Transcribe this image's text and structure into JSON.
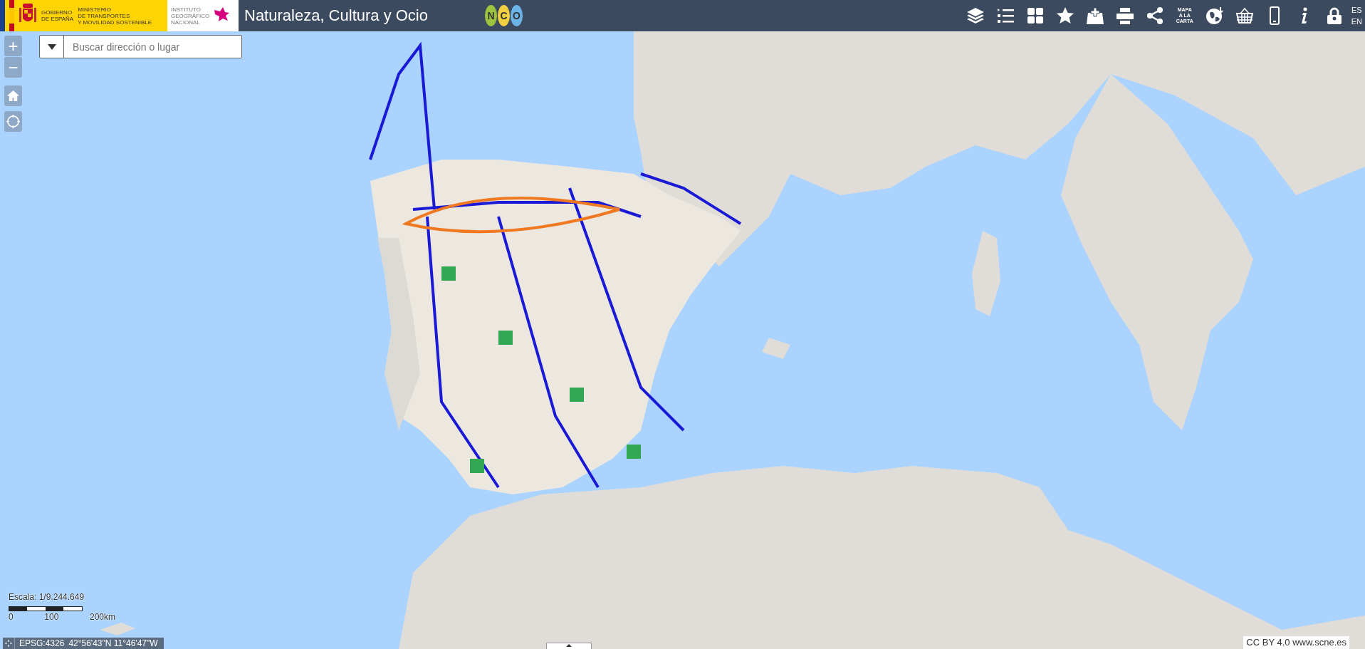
{
  "header": {
    "government": [
      "GOBIERNO",
      "DE ESPAÑA"
    ],
    "ministry": [
      "MINISTERIO",
      "DE TRANSPORTES",
      "Y MOVILIDAD SOSTENIBLE"
    ],
    "institute": [
      "INSTITUTO",
      "GEOGRÁFICO",
      "NACIONAL"
    ],
    "title": "Naturaleza, Cultura y Ocio",
    "app_logo": [
      "N",
      "C",
      "O"
    ]
  },
  "toolbar": [
    {
      "kind": "icon"
    },
    {
      "kind": "icon"
    },
    {
      "kind": "icon"
    },
    {
      "kind": "icon"
    },
    {
      "kind": "icon"
    },
    {
      "kind": "icon"
    },
    {
      "kind": "icon"
    },
    {
      "kind": "text",
      "lines": [
        "MAPA",
        "A LA",
        "CARTA"
      ]
    },
    {
      "kind": "icon"
    },
    {
      "kind": "icon"
    },
    {
      "kind": "icon"
    },
    {
      "kind": "icon"
    },
    {
      "kind": "icon"
    }
  ],
  "languages": [
    "ES",
    "EN"
  ],
  "map": {
    "kind": "picture"
  },
  "zoom": {
    "in": "+",
    "out": "−"
  },
  "search": {
    "placeholder": "Buscar dirección o lugar"
  },
  "scale": {
    "text": "Escala: 1/9.244.649",
    "ticks": [
      "0",
      "100",
      "200km"
    ]
  },
  "coordinates": {
    "projection": "EPSG:4326",
    "position": "42°56'43\"N 11°46'47\"W"
  },
  "attribution": "CC BY 4.0 www.scne.es"
}
